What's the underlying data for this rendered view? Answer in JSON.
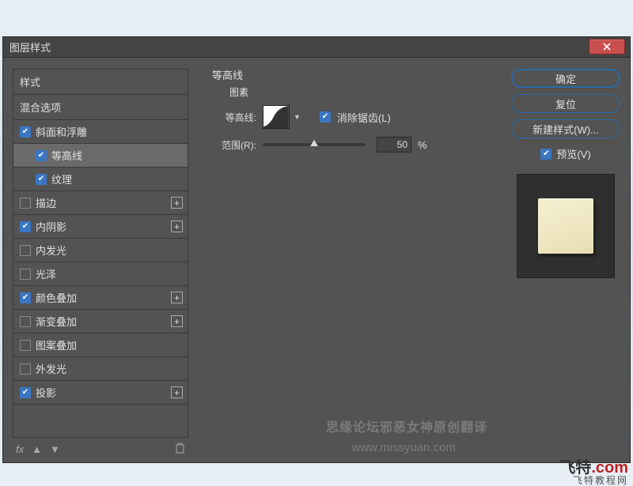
{
  "dialog": {
    "title": "图层样式"
  },
  "styles": {
    "header": "样式",
    "subheader": "混合选项",
    "items": [
      {
        "label": "斜面和浮雕",
        "checked": true,
        "indent": 0,
        "plus": false
      },
      {
        "label": "等高线",
        "checked": true,
        "indent": 1,
        "plus": false,
        "selected": true
      },
      {
        "label": "纹理",
        "checked": true,
        "indent": 1,
        "plus": false
      },
      {
        "label": "描边",
        "checked": false,
        "indent": 0,
        "plus": true
      },
      {
        "label": "内阴影",
        "checked": true,
        "indent": 0,
        "plus": true
      },
      {
        "label": "内发光",
        "checked": false,
        "indent": 0,
        "plus": false
      },
      {
        "label": "光泽",
        "checked": false,
        "indent": 0,
        "plus": false
      },
      {
        "label": "颜色叠加",
        "checked": true,
        "indent": 0,
        "plus": true
      },
      {
        "label": "渐变叠加",
        "checked": false,
        "indent": 0,
        "plus": true
      },
      {
        "label": "图案叠加",
        "checked": false,
        "indent": 0,
        "plus": false
      },
      {
        "label": "外发光",
        "checked": false,
        "indent": 0,
        "plus": false
      },
      {
        "label": "投影",
        "checked": true,
        "indent": 0,
        "plus": true
      }
    ],
    "fx_label": "fx"
  },
  "center": {
    "group_title": "等高线",
    "group_sub": "图素",
    "contour_label": "等高线:",
    "antialias_label": "消除锯齿(L)",
    "antialias_checked": true,
    "range_label": "范围(R):",
    "range_value": "50",
    "range_unit": "%"
  },
  "buttons": {
    "ok": "确定",
    "reset": "复位",
    "new_style": "新建样式(W)...",
    "preview": "预览(V)",
    "preview_checked": true
  },
  "watermarks": {
    "w1": "思缘论坛邪恶女神原创翻译",
    "w2": "www.missyuan.com",
    "footer_main_a": "飞特",
    "footer_main_b": ".com",
    "footer_sub": "飞特教程网"
  }
}
